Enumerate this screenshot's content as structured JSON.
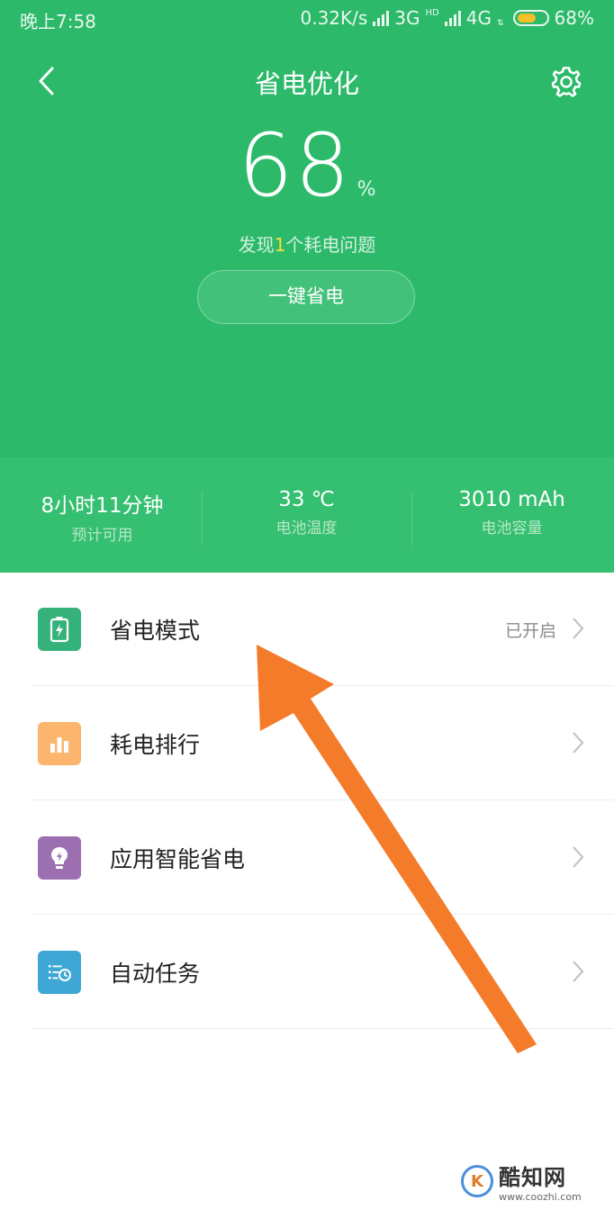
{
  "status_bar": {
    "time": "晚上7:58",
    "net_speed": "0.32K/s",
    "net_3g": "3G",
    "hd": "HD",
    "net_4g": "4G",
    "battery_text": "68%",
    "battery_level": 0.68,
    "battery_color": "#f5c02a"
  },
  "header": {
    "title": "省电优化",
    "battery_percent": "68",
    "percent_unit": "%",
    "issue_prefix": "发现",
    "issue_count": "1",
    "issue_suffix": "个耗电问题",
    "one_key_button": "一键省电",
    "bg_color": "#2cba6a"
  },
  "stats": [
    {
      "value": "8小时11分钟",
      "label": "预计可用"
    },
    {
      "value": "33 ℃",
      "label": "电池温度"
    },
    {
      "value": "3010 mAh",
      "label": "电池容量"
    }
  ],
  "menu": [
    {
      "label": "省电模式",
      "status": "已开启",
      "icon": "battery-saver-icon",
      "color": "#34b27a"
    },
    {
      "label": "耗电排行",
      "status": "",
      "icon": "bar-chart-icon",
      "color": "#fbb56c"
    },
    {
      "label": "应用智能省电",
      "status": "",
      "icon": "lightbulb-icon",
      "color": "#9c6fb1"
    },
    {
      "label": "自动任务",
      "status": "",
      "icon": "scheduled-list-icon",
      "color": "#3ea7d6"
    }
  ],
  "annotation": {
    "arrow_color": "#f47b2a"
  },
  "watermark": {
    "name": "酷知网",
    "url": "www.coozhi.com",
    "logo_letter": "K"
  }
}
